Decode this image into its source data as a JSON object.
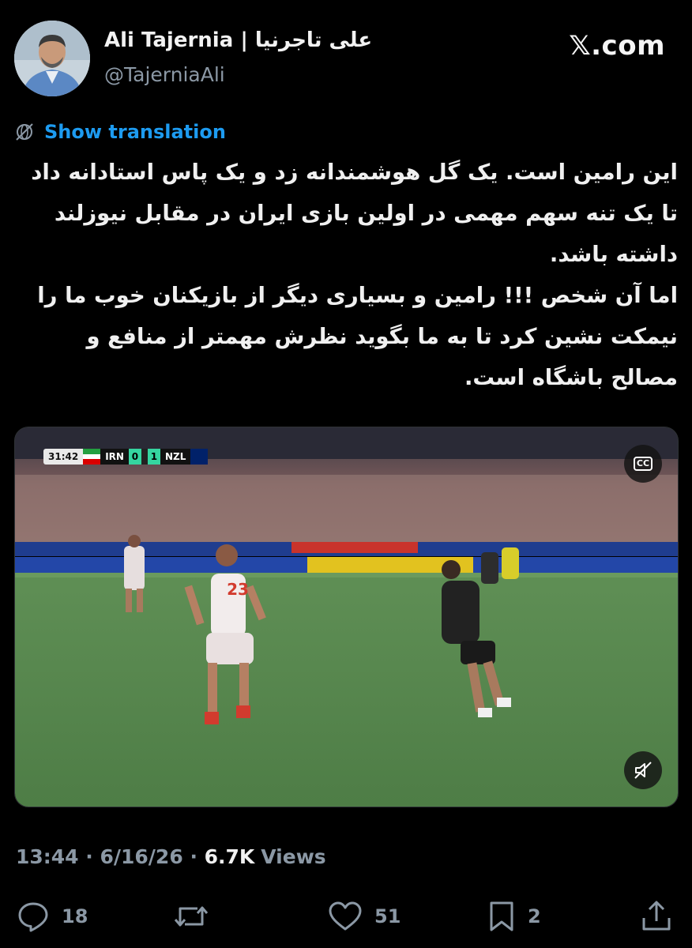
{
  "author": {
    "display_name": "Ali Tajernia | علی تاجرنیا",
    "handle": "@TajerniaAli",
    "avatar_icon": "profile-photo"
  },
  "watermark": "𝕏.com",
  "translate": {
    "label": "Show translation",
    "icon": "globe-crossed-icon"
  },
  "tweet": {
    "paragraph_1": "این رامین است. یک گل هوشمندانه زد و یک پاس استادانه داد تا یک تنه سهم مهمی در اولین بازی ایران در مقابل نیوزلند داشته باشد.",
    "paragraph_2": "اما آن شخص !!! رامین و بسیاری دیگر از بازیکنان خوب ما را نیمکت نشین کرد تا به ما بگوید نظرش مهمتر از منافع و مصالح باشگاه است."
  },
  "video": {
    "scoreboard": {
      "clock": "31:42",
      "home_team": "IRN",
      "home_score": "0",
      "away_score": "1",
      "away_team": "NZL"
    },
    "player_number": "23",
    "cc_label": "CC",
    "mute_icon": "speaker-muted-icon"
  },
  "meta": {
    "time": "13:44",
    "separator": " · ",
    "date": "6/16/26",
    "views_count": "6.7K",
    "views_label": "Views"
  },
  "actions": {
    "replies": "18",
    "reposts": "",
    "likes": "51",
    "bookmarks": "2"
  },
  "colors": {
    "background": "#000000",
    "link": "#1d9bf0",
    "muted": "#8b98a5",
    "text": "#e7e9ea"
  }
}
